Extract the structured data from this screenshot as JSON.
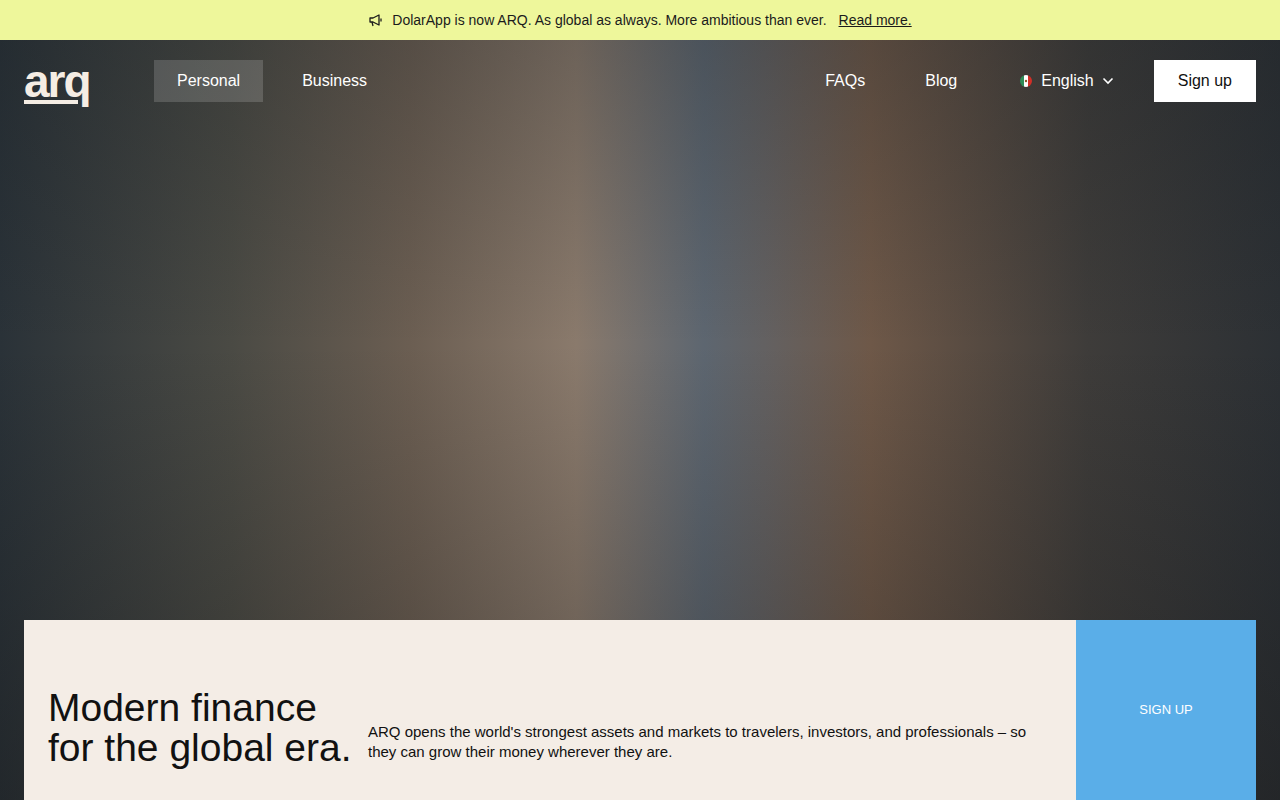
{
  "announcement": {
    "text": "DolarApp is now ARQ. As global as always. More ambitious than ever.",
    "link": "Read more."
  },
  "logo": "arq",
  "nav": {
    "tabs": [
      {
        "label": "Personal",
        "selected": true
      },
      {
        "label": "Business",
        "selected": false
      }
    ],
    "links": [
      "FAQs",
      "Blog"
    ],
    "language": "English",
    "signup": "Sign up"
  },
  "hero": {
    "title": "Modern finance for the global era.",
    "description": "ARQ opens the world's strongest assets and markets to travelers, investors, and professionals – so they can grow their money wherever they are.",
    "cta": "SIGN UP"
  }
}
